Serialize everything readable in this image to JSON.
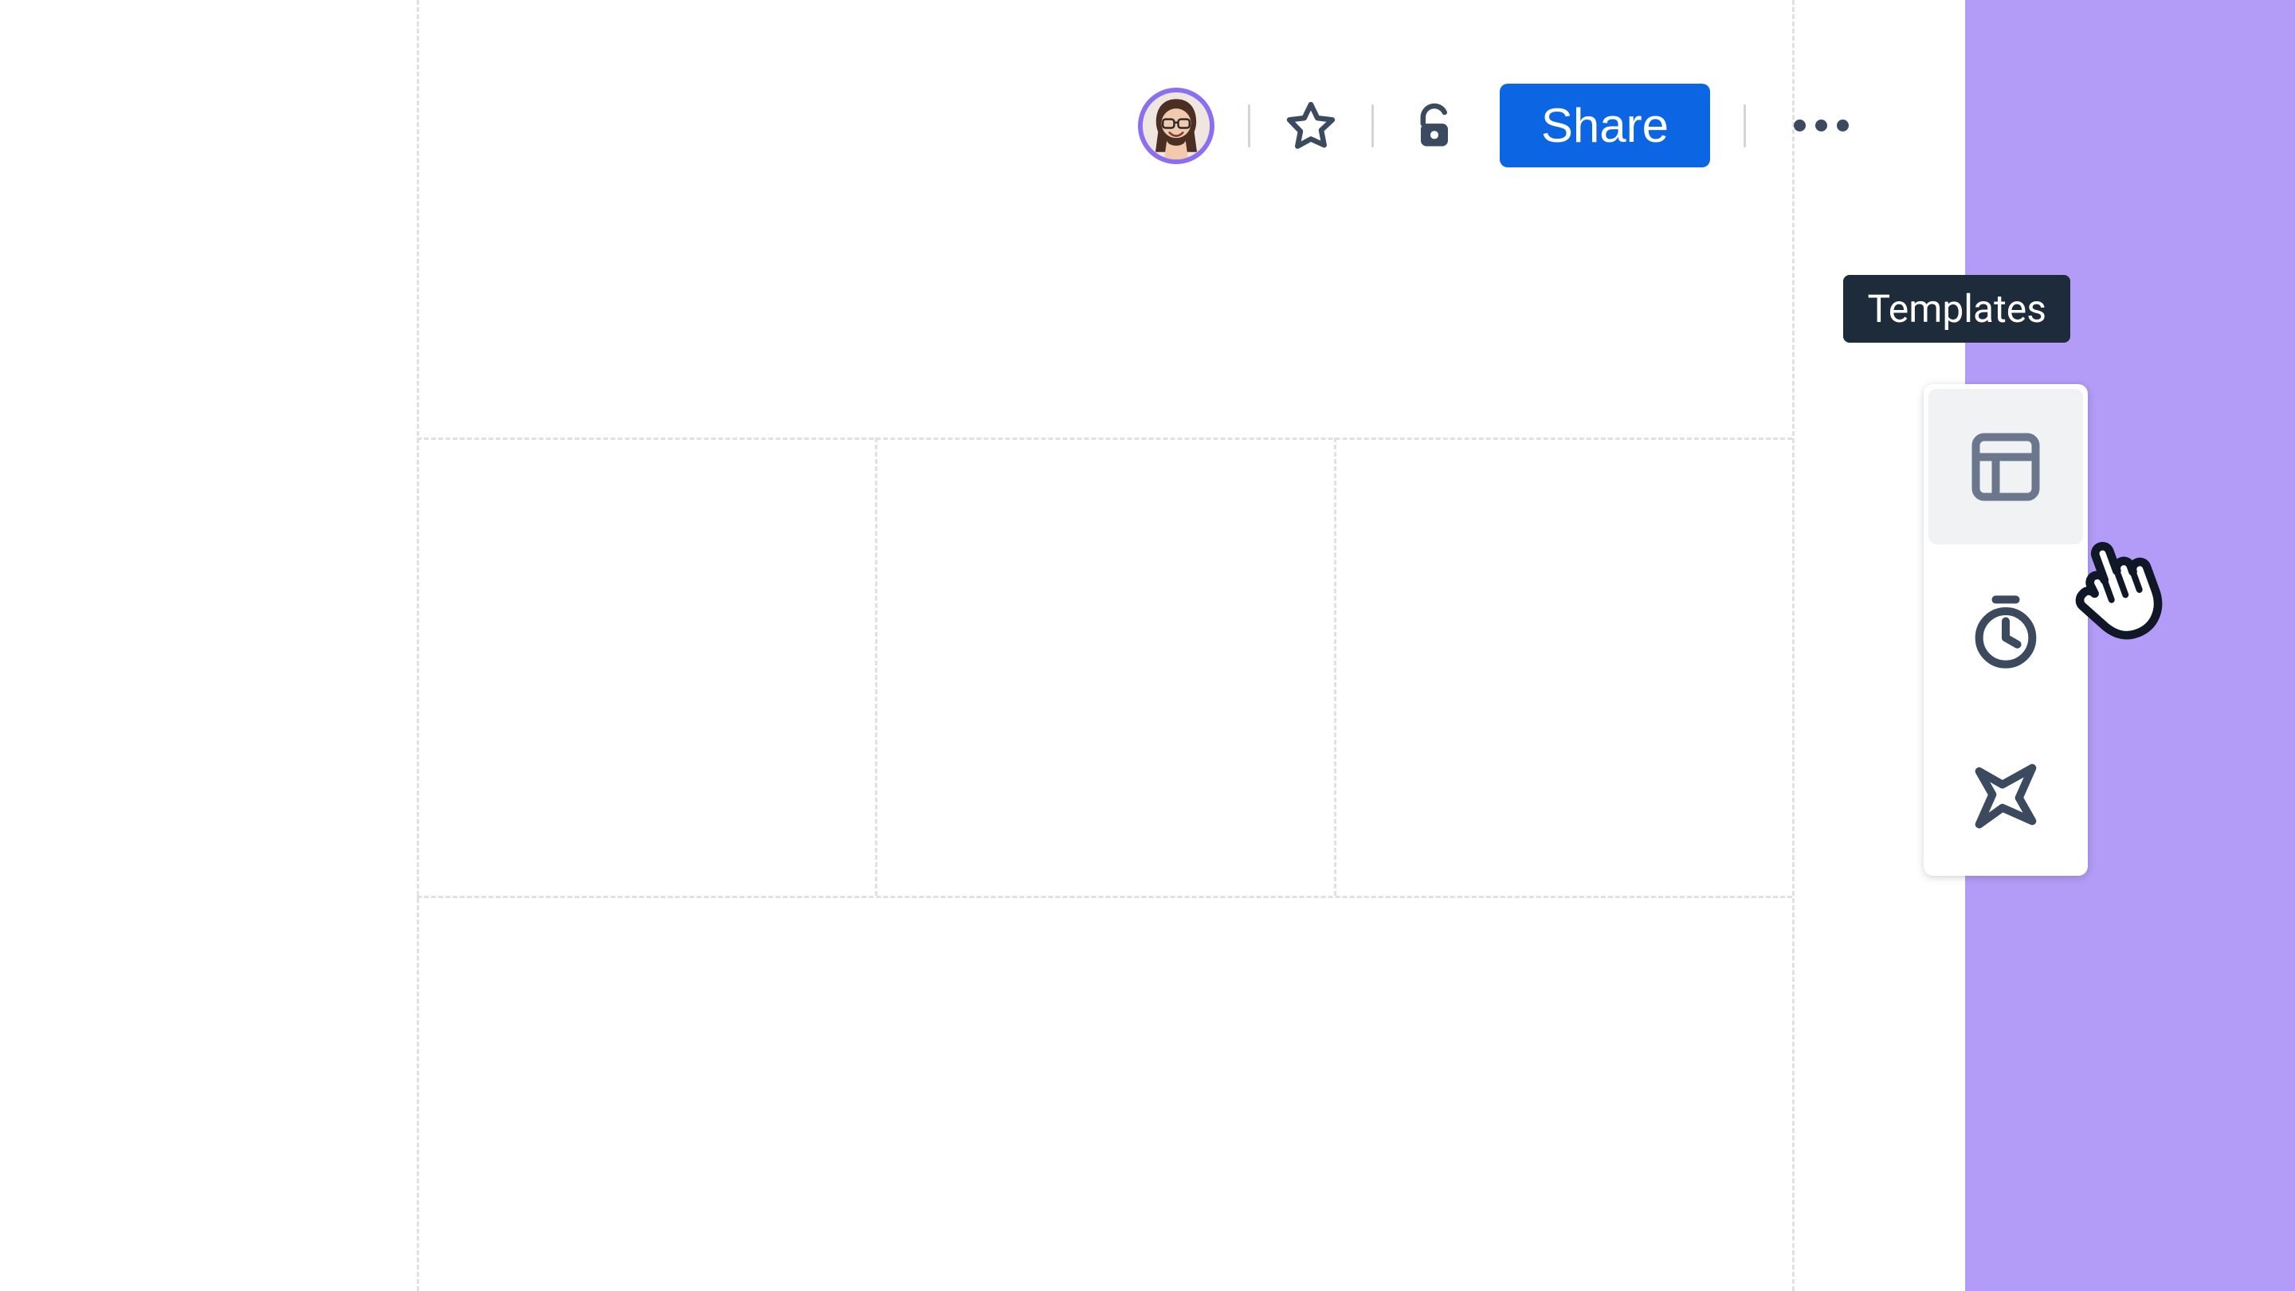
{
  "colors": {
    "accent_blue": "#0c66e4",
    "purple_panel": "#b29cf7",
    "tooltip_bg": "#1d2b3a",
    "icon": "#3b4a5e"
  },
  "toolbar": {
    "avatar_icon": "user-avatar",
    "star_icon": "star-icon",
    "lock_icon": "unlock-icon",
    "share_label": "Share",
    "more_icon": "more-horizontal-icon"
  },
  "tooltip": {
    "label": "Templates"
  },
  "float_panel": {
    "items": [
      {
        "name": "templates-button",
        "icon": "layout-icon",
        "active": true
      },
      {
        "name": "timer-button",
        "icon": "stopwatch-icon",
        "active": false
      },
      {
        "name": "apps-button",
        "icon": "app-star-icon",
        "active": false
      }
    ]
  },
  "cursor": {
    "icon": "pointer-hand-icon"
  }
}
